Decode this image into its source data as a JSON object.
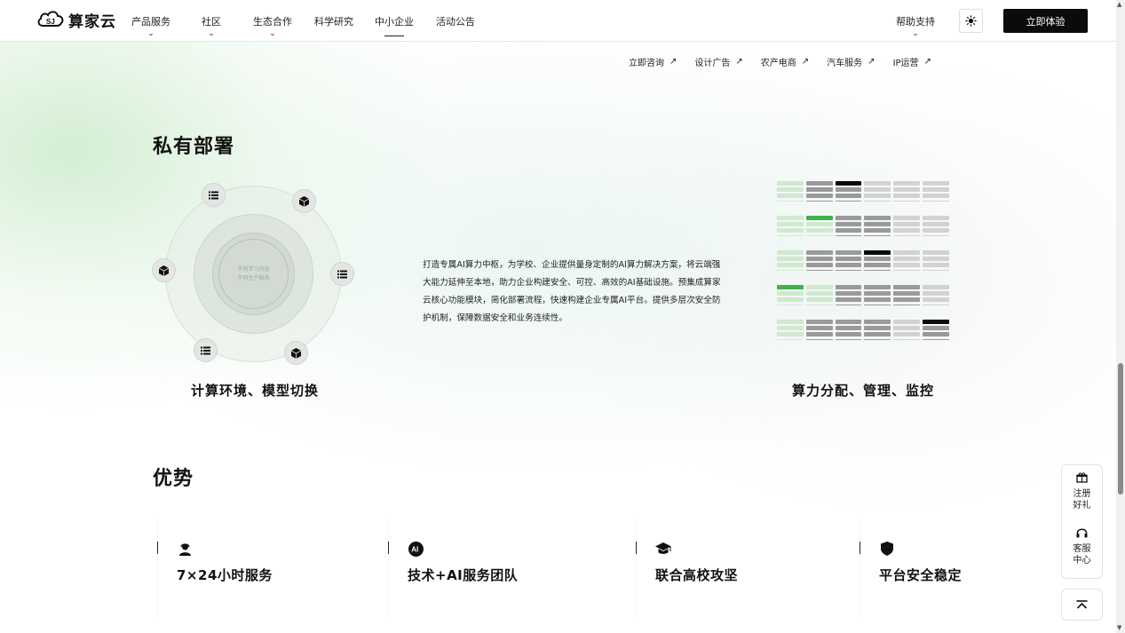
{
  "header": {
    "logo_text": "算家云",
    "nav": [
      {
        "label": "产品服务",
        "has_menu": true
      },
      {
        "label": "社区",
        "has_menu": true
      },
      {
        "label": "生态合作",
        "has_menu": true
      },
      {
        "label": "科学研究",
        "has_menu": false
      },
      {
        "label": "中小企业",
        "has_menu": false,
        "active": true
      },
      {
        "label": "活动公告",
        "has_menu": false
      }
    ],
    "help_label": "帮助支持",
    "theme_icon": "sun-icon",
    "cta_label": "立即体验"
  },
  "sublinks": [
    "立即咨询",
    "设计广告",
    "农产电商",
    "汽车服务",
    "IP运营"
  ],
  "private": {
    "title": "私有部署",
    "core_text": [
      "不同学习内容",
      "不同生产服务"
    ],
    "left_caption": "计算环境、模型切换",
    "description": "打造专属AI算力中枢，为学校、企业提供量身定制的AI算力解决方案，将云端强大能力延伸至本地，助力企业构建安全、可控、高效的AI基础设施。预集成算家云核心功能模块，简化部署流程，快速构建企业专属AI平台。提供多层次安全防护机制，保障数据安全和业务连续性。",
    "right_caption": "算力分配、管理、监控"
  },
  "advantages": {
    "title": "优势",
    "items": [
      {
        "label": "7×24小时服务",
        "icon": "support-agent-icon"
      },
      {
        "label": "技术+AI服务团队",
        "icon": "ai-badge-icon"
      },
      {
        "label": "联合高校攻坚",
        "icon": "graduation-cap-icon"
      },
      {
        "label": "平台安全稳定",
        "icon": "shield-icon"
      }
    ]
  },
  "float_panel": {
    "register": "注册好礼",
    "service": "客服中心"
  },
  "colors": {
    "accent_green": "#3cb34a",
    "dark": "#0b0b0b"
  }
}
